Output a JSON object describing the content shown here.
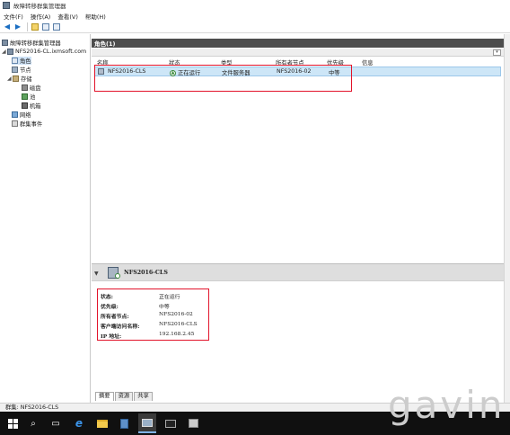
{
  "window": {
    "title": "故障转移群集管理器"
  },
  "menu": [
    "文件(F)",
    "操作(A)",
    "查看(V)",
    "帮助(H)"
  ],
  "tree": {
    "root": "故障转移群集管理器",
    "cluster": "NFS2016-CL.ixmsoft.com",
    "items": {
      "roles": "角色",
      "nodes": "节点",
      "storage": "存储",
      "disks": "磁盘",
      "pools": "池",
      "enclosures": "机箱",
      "networks": "网络",
      "events": "群集事件"
    }
  },
  "roles_pane": {
    "header": "角色(1)",
    "columns": [
      "名称",
      "状态",
      "类型",
      "所有者节点",
      "优先级",
      "信息"
    ],
    "rows": [
      {
        "name": "NFS2016-CLS",
        "status": "正在运行",
        "type": "文件服务器",
        "owner": "NFS2016-02",
        "priority": "中等",
        "info": ""
      }
    ]
  },
  "detail": {
    "name": "NFS2016-CLS",
    "properties": [
      {
        "label": "状态:",
        "value": "正在运行"
      },
      {
        "label": "优先级:",
        "value": "中等"
      },
      {
        "label": "所有者节点:",
        "value": "NFS2016-02"
      },
      {
        "label": "客户端访问名称:",
        "value": "NFS2016-CLS"
      },
      {
        "label": "IP 地址:",
        "value": "192.168.2.45"
      }
    ],
    "tabs": [
      "摘要",
      "资源",
      "共享"
    ]
  },
  "statusbar": {
    "text": "群集:  NFS2016-CLS"
  },
  "watermark": "gavin",
  "colors": {
    "highlight_red": "#e2132a",
    "header_dark": "#4d4d4d",
    "selection_blue": "#cde6f7"
  },
  "icons": [
    "back-arrow-icon",
    "forward-arrow-icon",
    "folder-up-icon",
    "help-icon",
    "properties-icon",
    "start-icon",
    "search-icon",
    "task-view-icon",
    "ie-icon",
    "explorer-icon",
    "server-manager-icon",
    "cluster-manager-icon",
    "cmd-icon",
    "app-icon"
  ]
}
